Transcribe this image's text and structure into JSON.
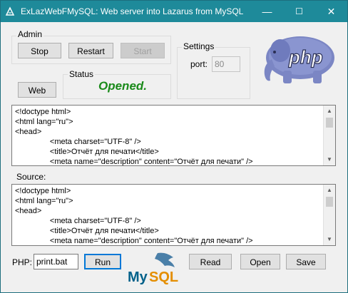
{
  "window": {
    "title": "ExLazWebFMySQL: Web server into Lazarus from MySQL",
    "minimize": "—",
    "maximize": "☐",
    "close": "✕",
    "titlebar_color": "#1e8a9a"
  },
  "admin": {
    "label": "Admin",
    "stop": "Stop",
    "restart": "Restart",
    "start": "Start"
  },
  "settings": {
    "label": "Settings",
    "port_label": "port:",
    "port_value": "80"
  },
  "web_button": "Web",
  "status": {
    "label": "Status",
    "value": "Opened.",
    "color": "#1a8a1a"
  },
  "output_memo": {
    "lines": [
      "<!doctype html>",
      "<html lang=\"ru\">",
      "<head>",
      "                <meta charset=\"UTF-8\" />",
      "                <title>Отчёт для печати</title>",
      "                <meta name=\"description\" content=\"Отчёт для печати\" />"
    ]
  },
  "source": {
    "label": "Source:",
    "lines": [
      "<!doctype html>",
      "<html lang=\"ru\">",
      "<head>",
      "                <meta charset=\"UTF-8\" />",
      "                <title>Отчёт для печати</title>",
      "                <meta name=\"description\" content=\"Отчёт для печати\" />"
    ]
  },
  "bottom": {
    "php_label": "PHP:",
    "php_value": "print.bat",
    "run": "Run",
    "read": "Read",
    "open": "Open",
    "save": "Save"
  },
  "logos": {
    "php_text": "php",
    "php_color": "#4f5b93",
    "mysql_my": "My",
    "mysql_sql": "SQL",
    "mysql_my_color": "#00618a",
    "mysql_sql_color": "#e48e00"
  }
}
